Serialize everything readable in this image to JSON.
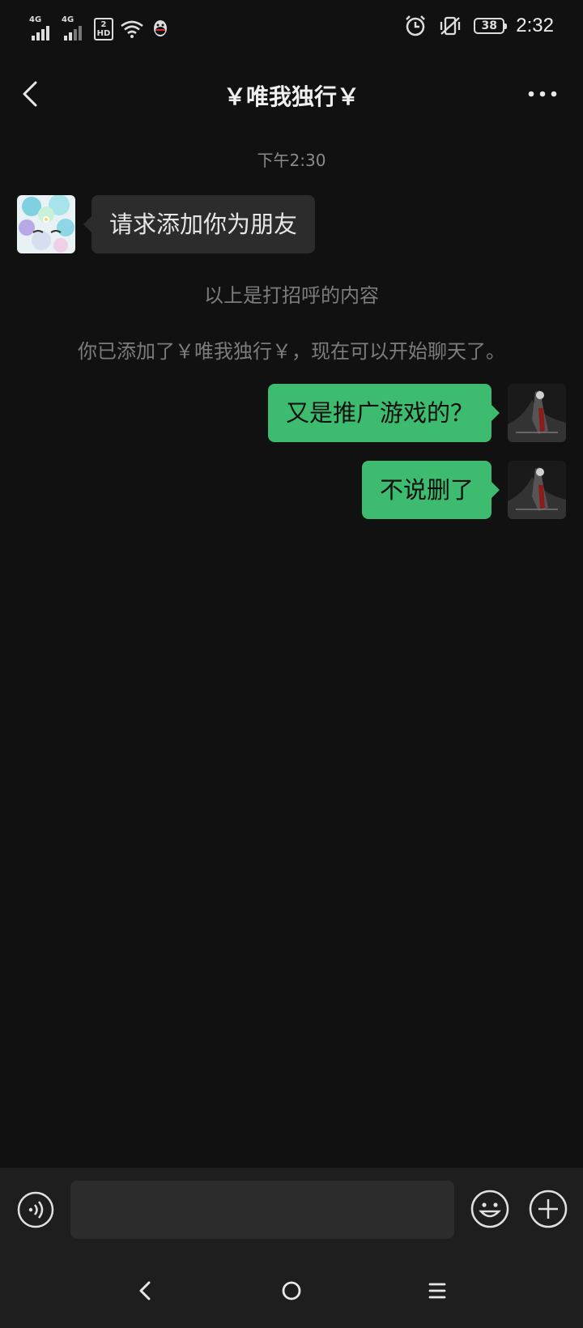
{
  "status_bar": {
    "network_1": "4G",
    "network_2": "4G",
    "hd_top": "2",
    "hd_bottom": "HD",
    "battery": "38",
    "time": "2:32",
    "icons": [
      "signal-icon",
      "signal-icon",
      "hd-icon",
      "wifi-icon",
      "qq-icon",
      "alarm-icon",
      "vibrate-off-icon",
      "battery-icon"
    ]
  },
  "header": {
    "title": "￥唯我独行￥",
    "back_icon": "chevron-left-icon",
    "more_icon": "more-dots-icon"
  },
  "chat": {
    "timestamp": "下午2:30",
    "incoming": {
      "text": "请求添加你为朋友"
    },
    "system_notes": [
      "以上是打招呼的内容",
      "你已添加了￥唯我独行￥，现在可以开始聊天了。"
    ],
    "outgoing": [
      {
        "text": "又是推广游戏的？"
      },
      {
        "text": "不说删了"
      }
    ]
  },
  "input_bar": {
    "value": "",
    "voice_icon": "voice-icon",
    "emoji_icon": "emoji-icon",
    "plus_icon": "plus-icon"
  },
  "colors": {
    "background": "#111111",
    "bubble_out": "#3dbb6f",
    "bubble_in": "#2c2c2c",
    "bar": "#1e1e1e"
  }
}
